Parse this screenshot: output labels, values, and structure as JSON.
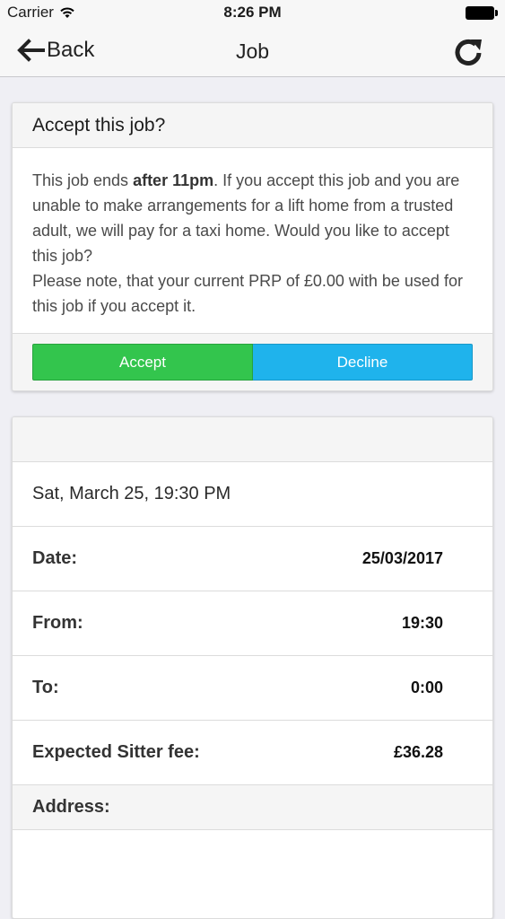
{
  "status_bar": {
    "carrier": "Carrier",
    "time": "8:26 PM",
    "icons": [
      "wifi-icon",
      "battery-icon"
    ]
  },
  "nav": {
    "back_label": "Back",
    "title": "Job",
    "icons": [
      "arrow-left-icon",
      "refresh-icon"
    ]
  },
  "accept_card": {
    "title": "Accept this job?",
    "body_prefix": "This job ends ",
    "body_bold": "after 11pm",
    "body_rest": ". If you accept this job and you are unable to make arrangements for a lift home from a trusted adult, we will pay for a taxi home. Would you like to accept this job?",
    "note": "Please note, that your current PRP of £0.00 with be used for this job if you accept it.",
    "accept_label": "Accept",
    "decline_label": "Decline",
    "colors": {
      "accept": "#33c54d",
      "decline": "#1fb3ec"
    }
  },
  "details": {
    "datetime": "Sat, March 25, 19:30 PM",
    "rows": [
      {
        "label": "Date:",
        "value": "25/03/2017"
      },
      {
        "label": "From:",
        "value": "19:30"
      },
      {
        "label": "To:",
        "value": "0:00"
      },
      {
        "label": "Expected Sitter fee:",
        "value": "£36.28"
      }
    ],
    "address_label": "Address:"
  }
}
